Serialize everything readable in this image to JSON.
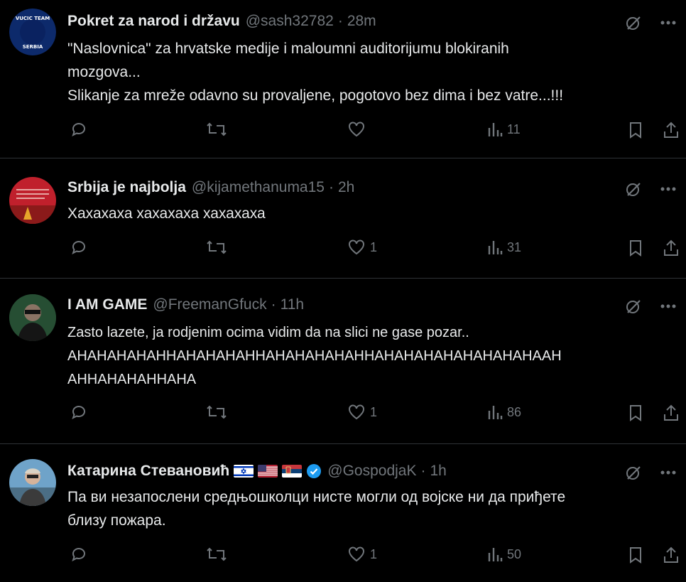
{
  "tweets": [
    {
      "name": "Pokret za narod i državu",
      "handle": "@sash32782",
      "time": "28m",
      "text": "\"Naslovnica\" za hrvatske medije i maloumni auditorijumu blokiranih\nmozgova...\nSlikanje za mreže odavno su provaljene, pogotovo bez dima i bez vatre...!!!",
      "avatar_text": "VUCIC TEAM SERBIA",
      "likes": "",
      "views": "11"
    },
    {
      "name": "Srbija je najbolja",
      "handle": "@kijamethanuma15",
      "time": "2h",
      "text": "Хахахаха хахахаха хахахаха",
      "likes": "1",
      "views": "31"
    },
    {
      "name": "I AM GAME",
      "handle": "@FreemanGfuck",
      "time": "11h",
      "text": "Zasto lazete, ja rodjenim ocima vidim da na slici ne gase pozar..\nAHAHAHAHAHHAHAHAHAHHAHAHAHAHAHHAHAHAHAHAHAHAHAHAAH\nAHHAHAHAHHAHA",
      "likes": "1",
      "views": "86"
    },
    {
      "name": "Катарина Стевановић",
      "handle": "@GospodjaK",
      "time": "1h",
      "text": "Па ви незапослени средњошколци нисте могли од војске ни да приђете\nблизу пожара.",
      "likes": "1",
      "views": "50"
    }
  ],
  "colors": {
    "background": "#000000",
    "text": "#e7e9ea",
    "muted": "#71767b",
    "divider": "#2f3336",
    "verified": "#1d9bf0"
  },
  "icons": [
    "reply-icon",
    "retweet-icon",
    "like-icon",
    "views-icon",
    "bookmark-icon",
    "share-icon",
    "grok-icon",
    "more-icon",
    "verified-icon"
  ]
}
